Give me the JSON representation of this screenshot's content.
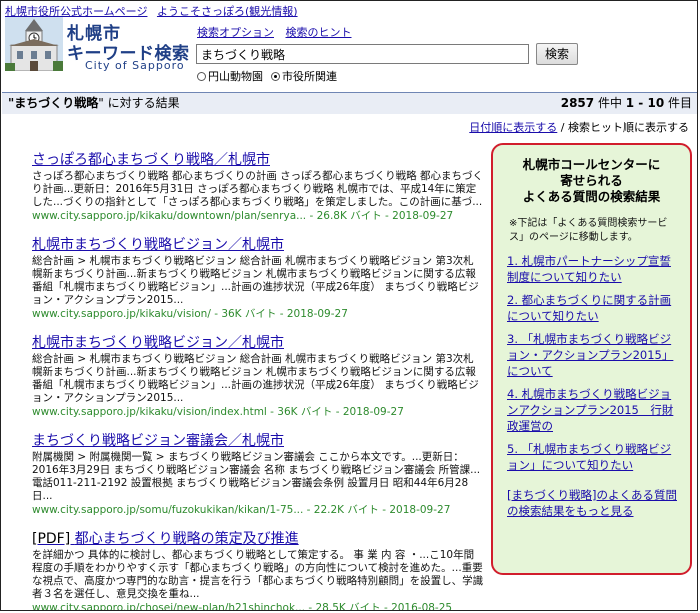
{
  "top_links": [
    "札幌市役所公式ホームページ",
    "ようこそさっぽろ(観光情報)"
  ],
  "logo": {
    "line1": "札幌市",
    "line2": "キーワード検索",
    "line3": "City of Sapporo"
  },
  "search": {
    "option_link": "検索オプション",
    "hint_link": "検索のヒント",
    "query": "まちづくり戦略",
    "button": "検索",
    "radio1": "円山動物園",
    "radio2": "市役所関連",
    "selected_radio": "radio2"
  },
  "results_bar": {
    "quote_open": "\"",
    "query_bold": "まちづくり戦略",
    "quote_close": "\" に対する結果",
    "count": "2857",
    "count_mid": " 件中 ",
    "range": "1 - 10",
    "count_suffix": " 件目"
  },
  "sort": {
    "by_date": "日付順に表示する",
    "separator": " / ",
    "by_hits": "検索ヒット順に表示する"
  },
  "results": [
    {
      "title": "さっぽろ都心まちづくり戦略／札幌市",
      "snippet": "さっぽろ都心まちづくり戦略 都心まちづくりの計画 さっぽろ都心まちづくり戦略 都心まちづくり計画...更新日：2016年5月31日 さっぽろ都心まちづくり戦略 札幌市では、平成14年に策定した...づくりの指針として「さっぽろ都心まちづくり戦略」を策定しました。この計画に基づ...",
      "url": "www.city.sapporo.jp/kikaku/downtown/plan/senrya... - 26.8K バイト - 2018-09-27"
    },
    {
      "title": "札幌市まちづくり戦略ビジョン／札幌市",
      "snippet": "総合計画 > 札幌市まちづくり戦略ビジョン 総合計画 札幌市まちづくり戦略ビジョン 第3次札幌新まちづくり計画...新まちづくり戦略ビジョン 札幌市まちづくり戦略ビジョンに関する広報番組「札幌市まちづくり戦略ビジョン」...計画の進捗状況（平成26年度） まちづくり戦略ビジョン・アクションプラン2015...",
      "url": "www.city.sapporo.jp/kikaku/vision/ - 36K バイト - 2018-09-27"
    },
    {
      "title": "札幌市まちづくり戦略ビジョン／札幌市",
      "snippet": "総合計画 > 札幌市まちづくり戦略ビジョン 総合計画 札幌市まちづくり戦略ビジョン 第3次札幌新まちづくり計画...新まちづくり戦略ビジョン 札幌市まちづくり戦略ビジョンに関する広報番組「札幌市まちづくり戦略ビジョン」...計画の進捗状況（平成26年度） まちづくり戦略ビジョン・アクションプラン2015...",
      "url": "www.city.sapporo.jp/kikaku/vision/index.html - 36K バイト - 2018-09-27"
    },
    {
      "title": "まちづくり戦略ビジョン審議会／札幌市",
      "snippet": "附属機関 > 附属機関一覧 > まちづくり戦略ビジョン審議会 ここから本文です。...更新日：2016年3月29日 まちづくり戦略ビジョン審議会 名称 まちづくり戦略ビジョン審議会 所管課...電話011-211-2192 設置根拠 まちづくり戦略ビジョン審議会条例 設置月日 昭和44年6月28日...",
      "url": "www.city.sapporo.jp/somu/fuzokukikan/kikan/1-75... - 22.2K バイト - 2018-09-27"
    },
    {
      "prefix": "[PDF] ",
      "title": "都心まちづくり戦略の策定及び推進",
      "snippet": "を詳細かつ 具体的に検討し、都心まちづくり戦略として策定する。 事 業 内 容 ・...こ10年間程度の手順をわかりやすく示す「都心まちづくり戦略」の方向性について検討を進めた。...重要な視点で、高度かつ専門的な助言・提言を行う「都心まちづくり戦略特別顧問」を設置し、学識者３名を選任し、意見交換を重ね...",
      "url": "www.city.sapporo.jp/chosei/new-plan/h21shinchok... - 28.5K バイト - 2016-08-25"
    }
  ],
  "sidebox": {
    "title_line1": "札幌市コールセンターに",
    "title_line2": "寄せられる",
    "title_line3": "よくある質問の検索結果",
    "note": "※下記は「よくある質問検索サービス」のページに移動します。",
    "links": [
      "1. 札幌市パートナーシップ宣誓制度について知りたい",
      "2. 都心まちづくりに関する計画について知りたい",
      "3. 「札幌市まちづくり戦略ビジョン・アクションプラン2015」について",
      "4. 札幌市まちづくり戦略ビジョンアクションプラン2015　行財政運営の",
      "5. 「札幌市まちづくり戦略ビジョン」について知りたい"
    ],
    "more": "[まちづくり戦略]のよくある質問の検索結果をもっと見る"
  },
  "colors": {
    "accent_red": "#d11d2c",
    "link_blue": "#1a0dab",
    "url_green": "#2e8b2e",
    "side_bg": "#e6f5d8",
    "bar_bg": "#e9edf5"
  },
  "icons": {
    "logo_image": "clock-tower-icon"
  }
}
